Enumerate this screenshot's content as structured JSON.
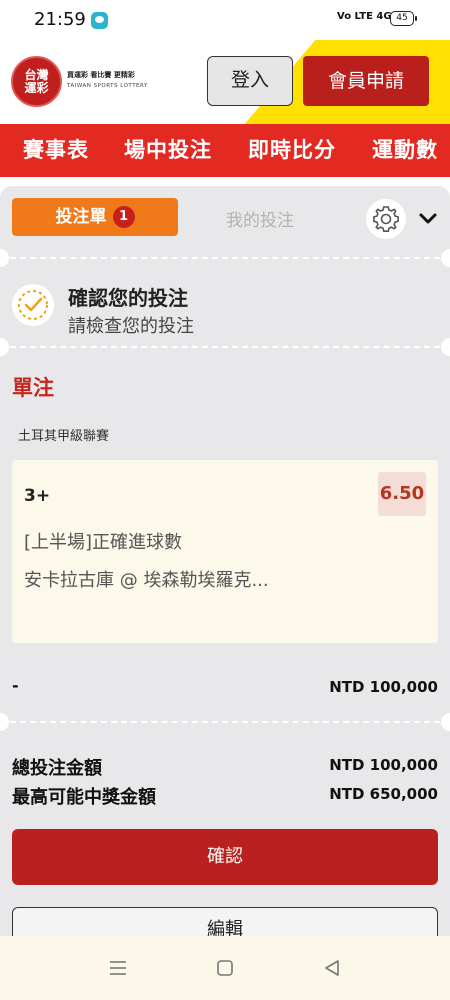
{
  "status_bar": {
    "time": "21:59",
    "network": "Vo LTE 4G",
    "battery": "45"
  },
  "header": {
    "logo_line1": "台灣",
    "logo_line2": "運彩",
    "tagline": "買運彩 看比賽 更精彩",
    "brand_en": "TAIWAN SPORTS LOTTERY",
    "login_label": "登入",
    "register_label": "會員申請"
  },
  "nav": {
    "tabs": [
      {
        "label": "賽事表"
      },
      {
        "label": "場中投注"
      },
      {
        "label": "即時比分"
      },
      {
        "label": "運動數"
      }
    ]
  },
  "betslip": {
    "tab_slip_label": "投注單",
    "slip_count": "1",
    "tab_mybets_label": "我的投注",
    "confirm_title": "確認您的投注",
    "confirm_subtitle": "請檢查您的投注",
    "section_title": "單注",
    "league": "土耳其甲級聯賽",
    "selection": "3+",
    "odds": "6.50",
    "market": "[上半場]正確進球數",
    "match": "安卡拉古庫 @ 埃森勒埃羅克...",
    "stake_label": "-",
    "stake_value": "NTD 100,000",
    "total_stake_label": "總投注金額",
    "total_stake_value": "NTD 100,000",
    "max_payout_label": "最高可能中獎金額",
    "max_payout_value": "NTD 650,000",
    "confirm_button": "確認",
    "back_button": "編輯"
  },
  "colors": {
    "brand_red": "#e22a23",
    "dark_red": "#b8211d",
    "orange": "#f07a1a",
    "yellow": "#ffe000"
  },
  "icons": {
    "gear": "gear-icon",
    "chevron": "chevron-down-icon",
    "confirm": "check-circle-icon"
  }
}
